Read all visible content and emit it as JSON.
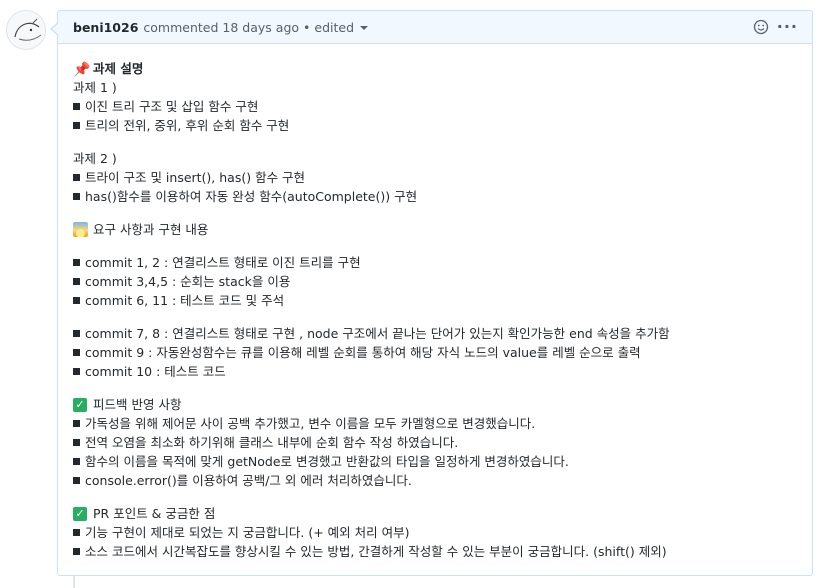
{
  "header": {
    "author": "beni1026",
    "action": "commented",
    "time": "18 days ago",
    "separator": "•",
    "edited": "edited",
    "smiley_icon": "smiley-icon",
    "menu_icon": "kebab-menu-icon",
    "menu_glyph": "···"
  },
  "body": {
    "section1_title": "과제 설명",
    "task1_label": "과제 1 )",
    "task1_items": [
      "이진 트리 구조 및 삽입 함수 구현",
      "트리의 전위, 중위, 후위 순회 함수 구현"
    ],
    "task2_label": "과제 2 )",
    "task2_items": [
      "트라이 구조 및 insert(), has() 함수 구현",
      "has()함수를 이용하여 자동 완성 함수(autoComplete()) 구현"
    ],
    "section2_title": "요구 사항과 구현 내용",
    "commits_a": [
      "commit 1, 2 : 연결리스트 형태로 이진 트리를 구현",
      "commit 3,4,5 : 순회는 stack을 이용",
      "commit 6, 11 : 테스트 코드 및 주석"
    ],
    "commits_b": [
      "commit 7, 8 : 연결리스트 형태로 구현 , node 구조에서 끝나는 단어가 있는지 확인가능한 end 속성을 추가함",
      "commit 9 : 자동완성함수는 큐를 이용해 레벨 순회를 통하여 해당 자식 노드의 value를 레벨 순으로 출력",
      "commit 10 : 테스트 코드"
    ],
    "section3_title": "피드백 반영 사항",
    "feedback_items": [
      "가독성을 위해 제어문 사이 공백 추가했고, 변수 이름을 모두 카멜형으로 변경했습니다.",
      "전역 오염을 최소화 하기위해 클래스 내부에 순회 함수 작성 하였습니다.",
      "함수의 이름을 목적에 맞게 getNode로 변경했고 반환값의 타입을 일정하게 변경하였습니다.",
      "console.error()를 이용하여 공백/그 외 에러 처리하였습니다."
    ],
    "section4_title": "PR 포인트 & 궁금한 점",
    "pr_items": [
      "기능 구현이 제대로 되었는 지 궁금합니다. (+ 예외 처리 여부)",
      "소스 코드에서 시간복잡도를 향상시킬 수 있는 방법, 간결하게 작성할 수 있는 부분이 궁금합니다. (shift() 제외)"
    ]
  },
  "colors": {
    "header_bg": "#f1f8ff",
    "border": "#c8e1ff",
    "check": "#27ae60"
  }
}
